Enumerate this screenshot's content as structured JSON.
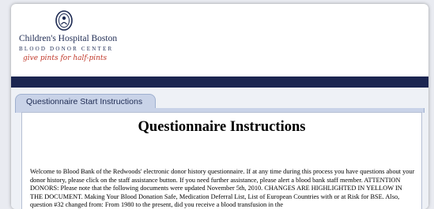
{
  "header": {
    "hospital_name": "Children's Hospital Boston",
    "center_name": "BLOOD DONOR CENTER",
    "tagline": "give pints for half-pints",
    "seal_icon": "hospital-seal-icon"
  },
  "tab": {
    "label": "Questionnaire Start Instructions"
  },
  "panel": {
    "title": "Questionnaire Instructions",
    "paragraphs": [
      "Welcome to Blood Bank of the Redwoods' electronic donor history questionnaire. If at any time during this process you have questions about your donor history, please click on the staff assistance button. If you need further assistance, please alert a blood bank staff member. ATTENTION DONORS: Please note that the following documents were updated November 5th, 2010. CHANGES ARE HIGHLIGHTED IN YELLOW IN THE DOCUMENT. Making Your Blood Donation Safe, Medication Deferral List, List of European Countries with or at Risk for BSE. Also, question #32 changed from: From 1980 to the present, did you receive a blood transfusion in the"
    ]
  },
  "colors": {
    "navy_bar": "#1b2550",
    "tab_background": "#c9d3e8",
    "tagline": "#c0392b",
    "page_background": "#e9ebf1"
  }
}
